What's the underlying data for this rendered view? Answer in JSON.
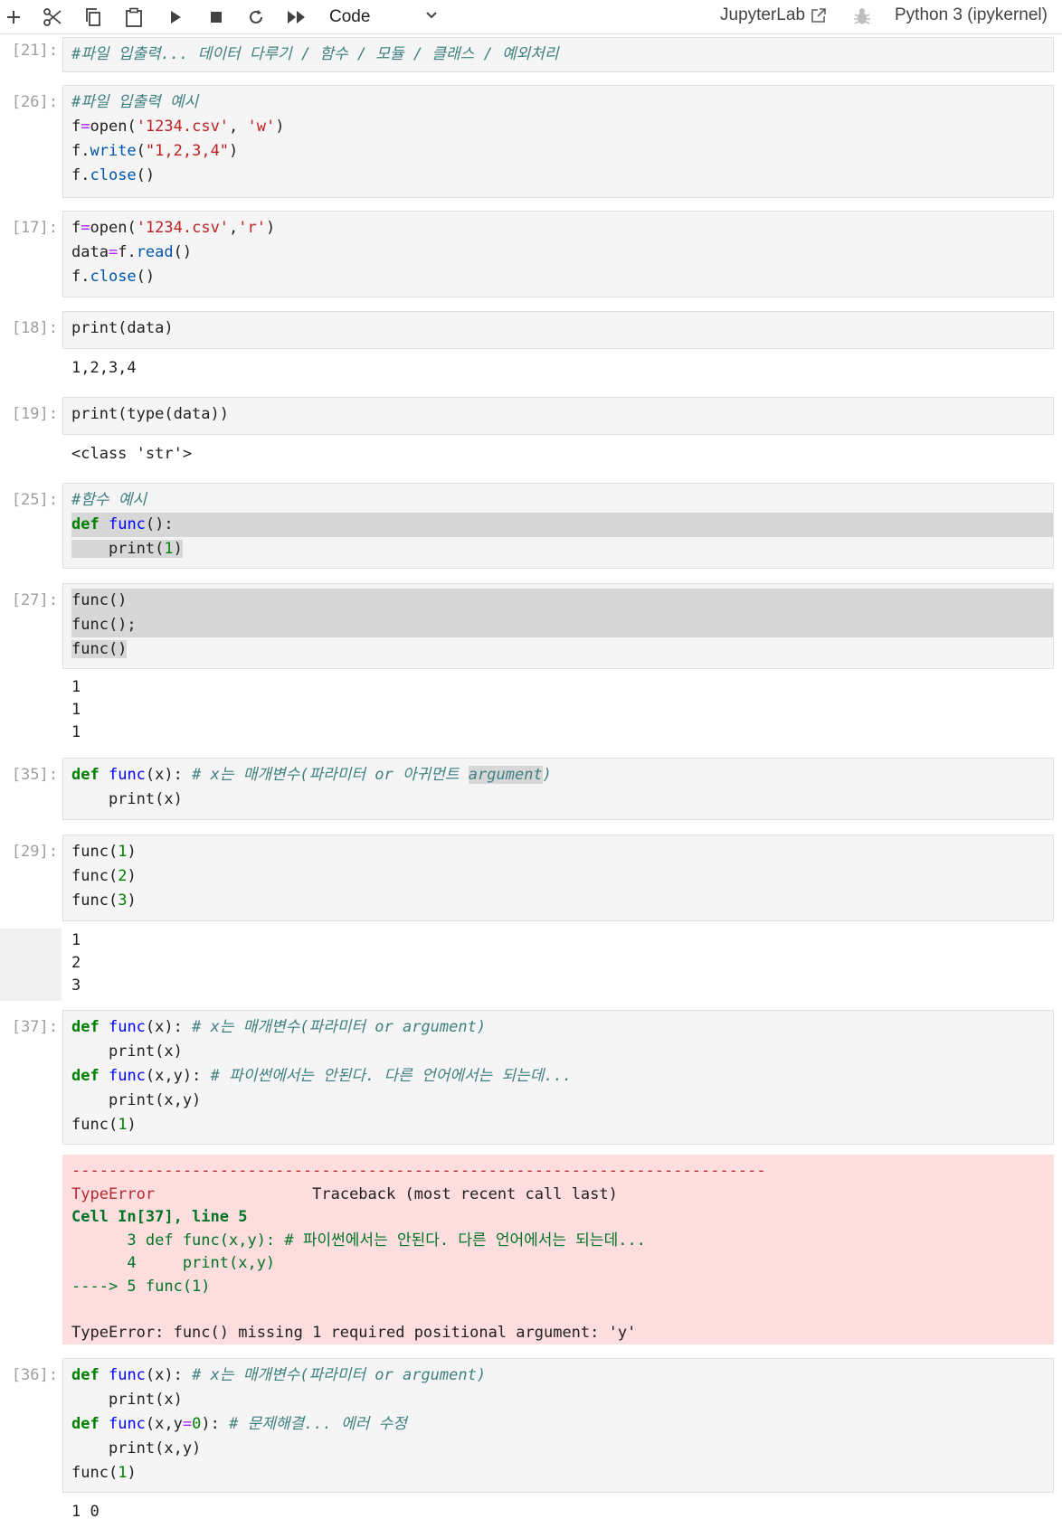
{
  "toolbar": {
    "cell_type": "Code",
    "jupyterlab_label": "JupyterLab",
    "kernel_label": "Python 3 (ipykernel)"
  },
  "cells": [
    {
      "prompt": "[21]:",
      "lines": [
        "#파일 입출력... 데이터 다루기 / 함수 / 모듈 / 클래스 / 예외처리"
      ]
    },
    {
      "prompt": "[26]:",
      "lines": [
        "#파일 입출력 예시",
        "f=open('1234.csv', 'w')",
        "f.write(\"1,2,3,4\")",
        "f.close()"
      ]
    },
    {
      "prompt": "[17]:",
      "lines": [
        "f=open('1234.csv','r')",
        "data=f.read()",
        "f.close()"
      ]
    },
    {
      "prompt": "[18]:",
      "lines": [
        "print(data)"
      ],
      "output": [
        "1,2,3,4"
      ]
    },
    {
      "prompt": "[19]:",
      "lines": [
        "print(type(data))"
      ],
      "output": [
        "<class 'str'>"
      ]
    },
    {
      "prompt": "[25]:",
      "lines": [
        "#함수 예시",
        "def func():",
        "    print(1)"
      ]
    },
    {
      "prompt": "[27]:",
      "lines": [
        "func()",
        "func();",
        "func()"
      ],
      "output": [
        "1",
        "1",
        "1"
      ]
    },
    {
      "prompt": "[35]:",
      "lines": [
        "def func(x): # x는 매개변수(파라미터 or 아귀먼트 argument)",
        "    print(x)"
      ]
    },
    {
      "prompt": "[29]:",
      "lines": [
        "func(1)",
        "func(2)",
        "func(3)"
      ],
      "output": [
        "1",
        "2",
        "3"
      ]
    },
    {
      "prompt": "[37]:",
      "lines": [
        "def func(x): # x는 매개변수(파라미터 or argument)",
        "    print(x)",
        "def func(x,y): # 파이썬에서는 안된다. 다른 언어에서는 되는데...",
        "    print(x,y)",
        "func(1)"
      ],
      "error": {
        "dashes": "---------------------------------------------------------------------------",
        "type": "TypeError",
        "traceback": "Traceback (most recent call last)",
        "cell_ref": "Cell In[37], line 5",
        "line3": "      3 def func(x,y): # 파이썬에서는 안된다. 다른 언어에서는 되는데...",
        "line4": "      4     print(x,y)",
        "line5": "----> 5 func(1)",
        "message": "TypeError: func() missing 1 required positional argument: 'y'"
      }
    },
    {
      "prompt": "[36]:",
      "lines": [
        "def func(x): # x는 매개변수(파라미터 or argument)",
        "    print(x)",
        "def func(x,y=0): # 문제해결... 에러 수정",
        "    print(x,y)",
        "func(1)"
      ],
      "output": [
        "1 0"
      ]
    }
  ]
}
